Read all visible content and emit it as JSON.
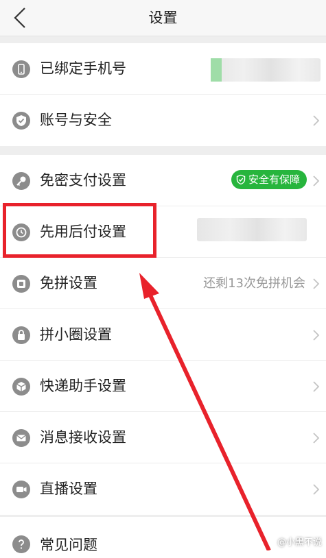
{
  "nav": {
    "title": "设置"
  },
  "group1": [
    {
      "label": "已绑定手机号",
      "icon": "phone-icon"
    },
    {
      "label": "账号与安全",
      "icon": "shield-check-icon"
    }
  ],
  "group2": [
    {
      "label": "免密支付设置",
      "icon": "key-icon",
      "badge": "安全有保障"
    },
    {
      "label": "先用后付设置",
      "icon": "pay-later-icon"
    },
    {
      "label": "免拼设置",
      "icon": "coupon-icon",
      "value": "还剩13次免拼机会"
    },
    {
      "label": "拼小圈设置",
      "icon": "lock-bag-icon"
    },
    {
      "label": "快递助手设置",
      "icon": "package-icon"
    },
    {
      "label": "消息接收设置",
      "icon": "mail-icon"
    },
    {
      "label": "直播设置",
      "icon": "video-icon"
    }
  ],
  "group3": [
    {
      "label": "常见问题",
      "icon": "question-icon"
    }
  ],
  "watermark": "@小黑不说",
  "colors": {
    "badge": "#27b53d",
    "highlight": "#e8222b",
    "icon": "#8c8c8c"
  }
}
